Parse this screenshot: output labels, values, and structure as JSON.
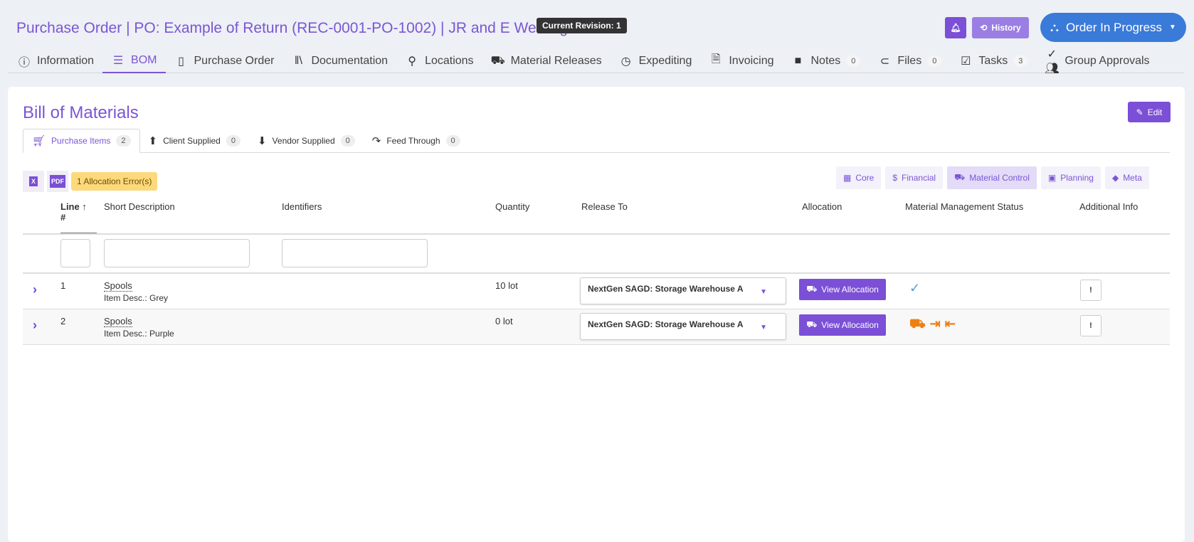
{
  "header": {
    "title": "Purchase Order | PO: Example of Return (REC-0001-PO-1002) | JR and E Welding",
    "revision": "Current Revision: 1",
    "history": "History",
    "status": "Order In Progress"
  },
  "nav": [
    {
      "label": "Information",
      "icon": "info-icon"
    },
    {
      "label": "BOM",
      "icon": "list-icon"
    },
    {
      "label": "Purchase Order",
      "icon": "book-icon"
    },
    {
      "label": "Documentation",
      "icon": "books-icon"
    },
    {
      "label": "Locations",
      "icon": "map-pin-icon"
    },
    {
      "label": "Material Releases",
      "icon": "truck-icon"
    },
    {
      "label": "Expediting",
      "icon": "history-icon"
    },
    {
      "label": "Invoicing",
      "icon": "file-icon"
    },
    {
      "label": "Notes",
      "icon": "note-icon",
      "count": "0"
    },
    {
      "label": "Files",
      "icon": "paperclip-icon",
      "count": "0"
    },
    {
      "label": "Tasks",
      "icon": "clipboard-check-icon",
      "count": "3"
    },
    {
      "label": "Group Approvals",
      "icon": "users-check-icon"
    }
  ],
  "bom": {
    "title": "Bill of Materials",
    "edit": "Edit",
    "subtabs": [
      {
        "label": "Purchase Items",
        "count": "2"
      },
      {
        "label": "Client Supplied",
        "count": "0"
      },
      {
        "label": "Vendor Supplied",
        "count": "0"
      },
      {
        "label": "Feed Through",
        "count": "0"
      }
    ],
    "excel": "X",
    "pdf": "PDF",
    "error": "1 Allocation Error(s)",
    "column_toggles": [
      "Core",
      "Financial",
      "Material Control",
      "Planning",
      "Meta"
    ],
    "columns": {
      "line": "Line",
      "hash": "#",
      "short": "Short Description",
      "ident": "Identifiers",
      "qty": "Quantity",
      "release": "Release To",
      "alloc": "Allocation",
      "mms": "Material Management Status",
      "info": "Additional Info"
    },
    "rows": [
      {
        "line": "1",
        "desc": "Spools",
        "item_desc": "Item Desc.: Grey",
        "qty": "10 lot",
        "release": "NextGen SAGD: Storage Warehouse A",
        "alloc": "View Allocation",
        "status": "ok"
      },
      {
        "line": "2",
        "desc": "Spools",
        "item_desc": "Item Desc.: Purple",
        "qty": "0 lot",
        "release": "NextGen SAGD: Storage Warehouse A",
        "alloc": "View Allocation",
        "status": "errors"
      }
    ]
  },
  "colors": {
    "accent": "#7b4fd6",
    "status": "#3a7ad9",
    "warning": "#f07f12",
    "error_badge": "#fdd97c"
  }
}
